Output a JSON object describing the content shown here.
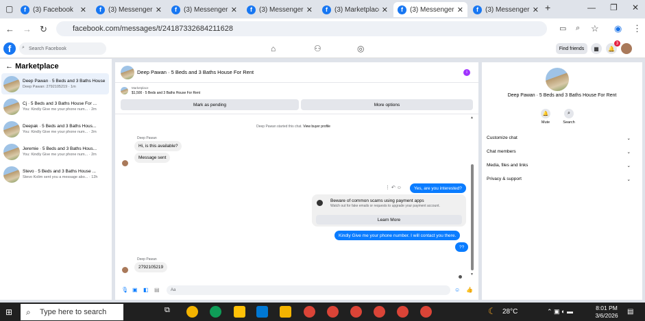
{
  "browser": {
    "tabs": [
      {
        "label": "(3) Facebook",
        "active": false
      },
      {
        "label": "(3) Messenger |",
        "active": false
      },
      {
        "label": "(3) Messenger |",
        "active": false
      },
      {
        "label": "(3) Messenger |",
        "active": false
      },
      {
        "label": "(3) Marketplace",
        "active": false
      },
      {
        "label": "(3) Messenger |",
        "active": true
      },
      {
        "label": "(3) Messenger |",
        "active": false
      }
    ],
    "url": "facebook.com/messages/t/24187332684211628"
  },
  "fb_header": {
    "search_placeholder": "Search Facebook",
    "find_friends": "Find friends",
    "notif_count": "3"
  },
  "sidebar": {
    "title": "Marketplace",
    "conversations": [
      {
        "title": "Deep Pawan · 5 Beds and 3 Baths House For Rent",
        "preview": "Deep Pawan: 2792105219 · 1m",
        "selected": true
      },
      {
        "title": "Cj · 5 Beds and 3 Baths House For ...",
        "preview": "You: Kindly Give me your phone num... · 2m",
        "selected": false
      },
      {
        "title": "Deepak · 5 Beds and 3 Baths Hous...",
        "preview": "You: Kindly Give me your phone num... · 2m",
        "selected": false
      },
      {
        "title": "Jeremie · 5 Beds and 3 Baths Hous...",
        "preview": "You: Kindly Give me your phone num... · 2m",
        "selected": false
      },
      {
        "title": "Stevo · 5 Beds and 3 Baths House ...",
        "preview": "Stevo Kolim sent you a message abo... · 12h",
        "selected": false
      }
    ]
  },
  "chat": {
    "title": "Deep Pawan · 5 Beds and 3 Baths House For Rent",
    "marketplace_label": "Marketplace",
    "listing": "$1,500 · 5 Beds and 3 Baths House For Rent",
    "mark_pending": "Mark as pending",
    "more_options": "More options",
    "started_text": "Deep Pawan started this chat.",
    "view_profile": "View buyer profile",
    "sender": "Deep Pawan",
    "msg1": "Hi, is this available?",
    "msg2": "Message sent",
    "reply1": "Yes, are you interested?",
    "scam_title": "Beware of common scams using payment apps",
    "scam_sub": "Watch out for fake emails or requests to upgrade your payment account.",
    "learn_more": "Learn More",
    "reply2": "Kindly Give me your phone number. I will contact you there.",
    "reply3": "??",
    "sender2": "Deep Pawan",
    "msg3": "2792105219",
    "input_placeholder": "Aa"
  },
  "details": {
    "title": "Deep Pawan · 5 Beds and 3 Baths House For Rent",
    "mute": "Mute",
    "search": "Search",
    "rows": [
      "Customize chat",
      "Chat members",
      "Media, files and links",
      "Privacy & support"
    ]
  },
  "taskbar": {
    "search_placeholder": "Type here to search",
    "temperature": "28°C",
    "time": "8:01 PM",
    "date": "3/6/2026"
  }
}
